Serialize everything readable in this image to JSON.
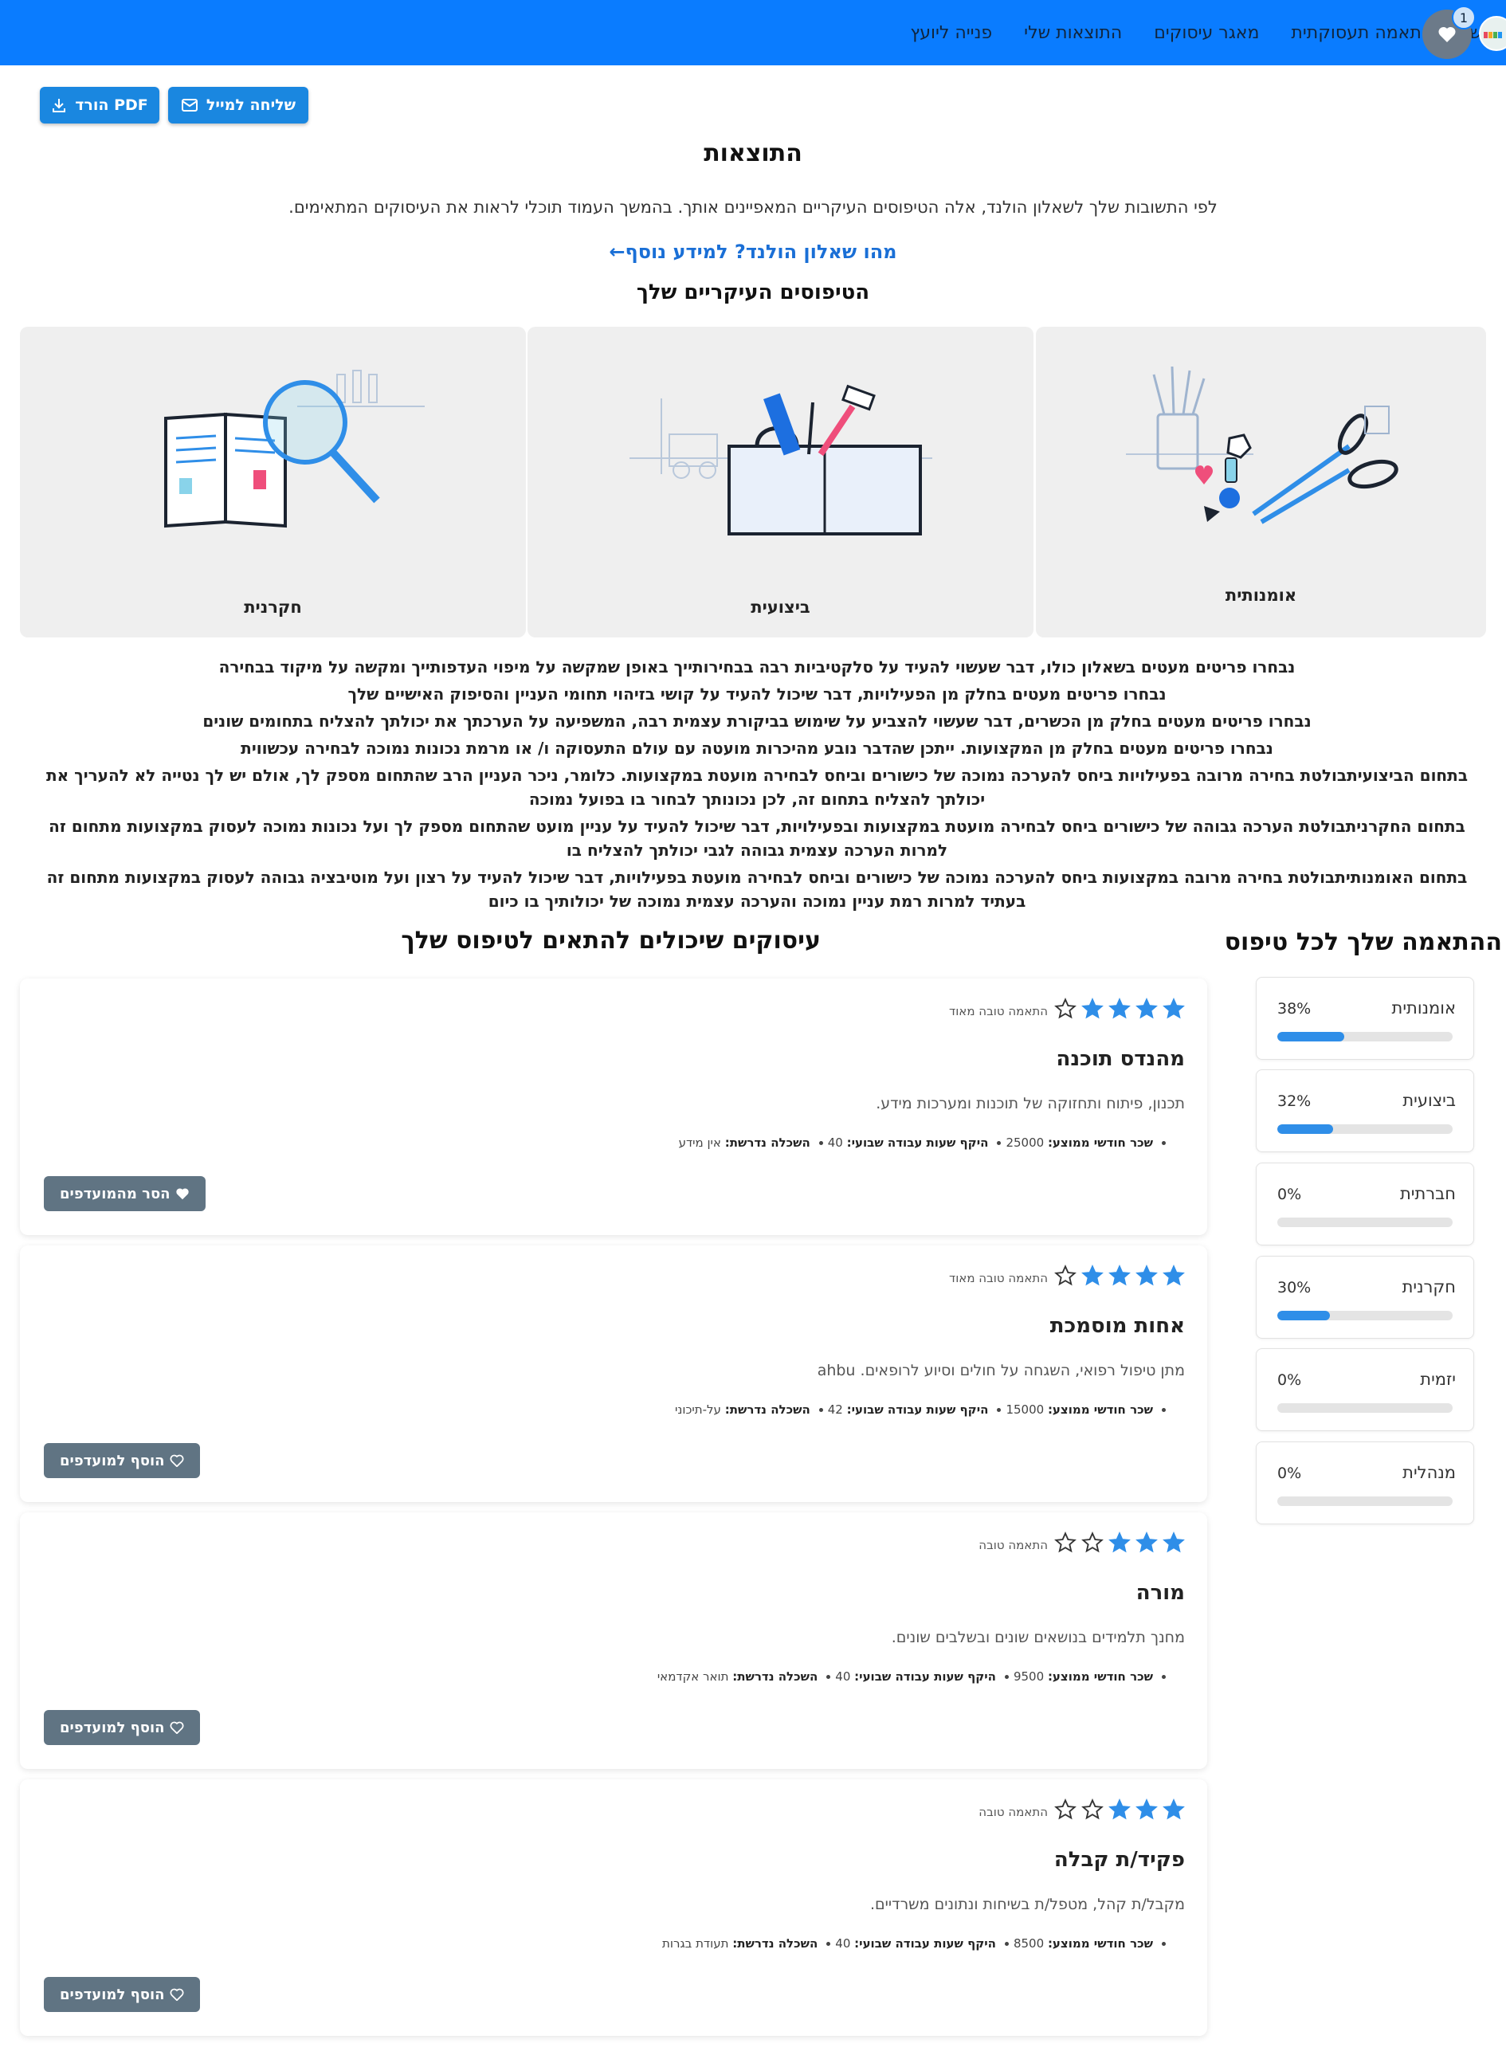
{
  "nav": {
    "links": [
      "שאלון התאמה תעסוקתית",
      "מאגר עיסוקים",
      "התוצאות שלי",
      "פנייה ליועץ"
    ],
    "favorites_count": "1"
  },
  "actions": {
    "email_label": "שליחה למייל",
    "pdf_label": "PDF הורד"
  },
  "results": {
    "title": "התוצאות",
    "intro": "לפי התשובות שלך לשאלון הולנד, אלה הטיפוסים העיקריים המאפיינים אותך. בהמשך העמוד תוכלי לראות את העיסוקים המתאימים.",
    "more_info_link": "מהו שאלון הולנד? למידע נוסף←",
    "types_title": "הטיפוסים העיקריים שלך"
  },
  "top_types": [
    {
      "label": "אומנותית",
      "icon": "art-supplies-illustration"
    },
    {
      "label": "ביצועית",
      "icon": "toolbox-illustration"
    },
    {
      "label": "חקרנית",
      "icon": "book-magnifier-illustration"
    }
  ],
  "explanations": [
    "נבחרו פריטים מעטים בשאלון כולו, דבר שעשוי להעיד על סלקטיביות רבה בבחירותייך באופן שמקשה על מיפוי העדפותייך ומקשה על מיקוד בבחירה",
    "נבחרו פריטים מעטים בחלק מן הפעילויות, דבר שיכול להעיד על קושי בזיהוי תחומי העניין והסיפוק האישיים שלך",
    "נבחרו פריטים מעטים בחלק מן הכשרים, דבר שעשוי להצביע על שימוש בביקורת עצמית רבה, המשפיעה על הערכתך את יכולתך להצליח בתחומים שונים",
    "נבחרו פריטים מעטים בחלק מן המקצועות. ייתכן שהדבר נובע מהיכרות מועטה עם עולם התעסוקה ו/ או מרמת נכונות נמוכה לבחירה עכשווית",
    "בתחום הביצועיתבולטת בחירה מרובה בפעילויות ביחס להערכה נמוכה של כישורים וביחס לבחירה מועטת במקצועות. כלומר, ניכר העניין הרב שהתחום מספק לך, אולם יש לך נטייה לא להעריך את יכולתך להצליח בתחום זה, לכן נכונותך לבחור בו בפועל נמוכה",
    "בתחום החקרניתבולטת הערכה גבוהה של כישורים ביחס לבחירה מועטת במקצועות ובפעילויות, דבר שיכול להעיד על עניין מועט שהתחום מספק לך ועל נכונות נמוכה לעסוק במקצועות מתחום זה למרות הערכה עצמית גבוהה לגבי יכולתך להצליח בו",
    "בתחום האומנותיתבולטת בחירה מרובה במקצועות ביחס להערכה נמוכה של כישורים וביחס לבחירה מועטת בפעילויות, דבר שיכול להעיד על רצון ועל מוטיבציה גבוהה לעסוק במקצועות מתחום זה בעתיד למרות רמת עניין נמוכה והערכה עצמית נמוכה של יכולותיך בו כיום"
  ],
  "match": {
    "title": "ההתאמה שלך לכל טיפוס",
    "items": [
      {
        "name": "אומנותית",
        "percent_label": "38%",
        "value": 38
      },
      {
        "name": "ביצועית",
        "percent_label": "32%",
        "value": 32
      },
      {
        "name": "חברתית",
        "percent_label": "0%",
        "value": 0
      },
      {
        "name": "חקרנית",
        "percent_label": "30%",
        "value": 30
      },
      {
        "name": "יזמית",
        "percent_label": "0%",
        "value": 0
      },
      {
        "name": "מנהלית",
        "percent_label": "0%",
        "value": 0
      }
    ]
  },
  "jobs": {
    "title": "עיסוקים שיכולים להתאים לטיפוס שלך",
    "detail_labels": {
      "salary": "שכר חודשי ממוצע:",
      "hours": "היקף שעות עבודה שבועי:",
      "education": "השכלה נדרשת:"
    },
    "items": [
      {
        "rating": 4,
        "rating_label": "התאמה טובה מאוד",
        "title": "מהנדס תוכנה",
        "description": "תכנון, פיתוח ותחזוקה של תוכנות ומערכות מידע.",
        "salary": "25000",
        "hours": "40",
        "education": "אין מידע",
        "button": "הסר מהמועדפים",
        "favorite": true
      },
      {
        "rating": 4,
        "rating_label": "התאמה טובה מאוד",
        "title": "אחות מוסמכת",
        "description": "מתן טיפול רפואי, השגחה על חולים וסיוע לרופאים. ahbu",
        "salary": "15000",
        "hours": "42",
        "education": "על-תיכוני",
        "button": "הוסף למועדפים",
        "favorite": false
      },
      {
        "rating": 3,
        "rating_label": "התאמה טובה",
        "title": "מורה",
        "description": "מחנך תלמידים בנושאים שונים ובשלבים שונים.",
        "salary": "9500",
        "hours": "40",
        "education": "תואר אקדמאי",
        "button": "הוסף למועדפים",
        "favorite": false
      },
      {
        "rating": 3,
        "rating_label": "התאמה טובה",
        "title": "פקיד/ת קבלה",
        "description": "מקבל/ת קהל, מטפל/ת בשיחות ונתונים משרדיים.",
        "salary": "8500",
        "hours": "40",
        "education": "תעודת בגרות",
        "button": "הוסף למועדפים",
        "favorite": false
      }
    ]
  },
  "colors": {
    "nav_bg": "#0a7cff",
    "accent": "#1a87e0",
    "star": "#2f8ee8",
    "fav_button": "#607483"
  }
}
